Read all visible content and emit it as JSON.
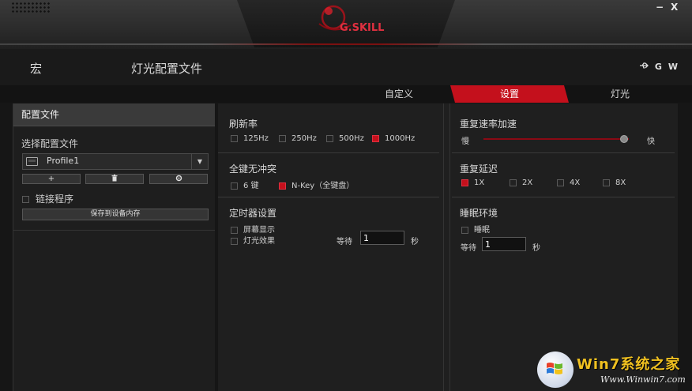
{
  "window": {
    "logo_text": "G.SKILL",
    "minimize": "−",
    "close": "X"
  },
  "nav": {
    "macro": "宏",
    "lighting_profile": "灯光配置文件",
    "icon_g": "G",
    "icon_w": "W"
  },
  "tabs": {
    "custom": "自定义",
    "settings": "设置",
    "lighting": "灯光"
  },
  "profile_panel": {
    "header": "配置文件",
    "select_label": "选择配置文件",
    "selected_profile": "Profile1",
    "add_button": "+",
    "link_program": "链接程序",
    "save_to_device": "保存到设备内存"
  },
  "settings": {
    "polling_rate": {
      "title": "刷新率",
      "options": [
        "125Hz",
        "250Hz",
        "500Hz",
        "1000Hz"
      ],
      "selected": "1000Hz"
    },
    "anti_ghost": {
      "title": "全键无冲突",
      "options": [
        "6 键",
        "N-Key（全键盘）"
      ],
      "selected": "N-Key（全键盘）"
    },
    "timer": {
      "title": "定时器设置",
      "screen_display": "屏幕显示",
      "light_effect": "灯光效果",
      "wait_label": "等待",
      "wait_value": "1",
      "unit": "秒"
    },
    "repeat_rate": {
      "title": "重复速率加速",
      "slow": "慢",
      "fast": "快",
      "level": 0.96
    },
    "repeat_delay": {
      "title": "重复延迟",
      "options": [
        "1X",
        "2X",
        "4X",
        "8X"
      ],
      "selected": "1X"
    },
    "sleep": {
      "title": "睡眠环境",
      "sleep_label": "睡眠",
      "wait_label": "等待",
      "wait_value": "1",
      "unit": "秒"
    }
  },
  "watermark": {
    "title": "Win7系统之家",
    "url": "Www.Winwin7.com"
  },
  "colors": {
    "accent": "#c4101c",
    "background": "#1f1f1f"
  }
}
